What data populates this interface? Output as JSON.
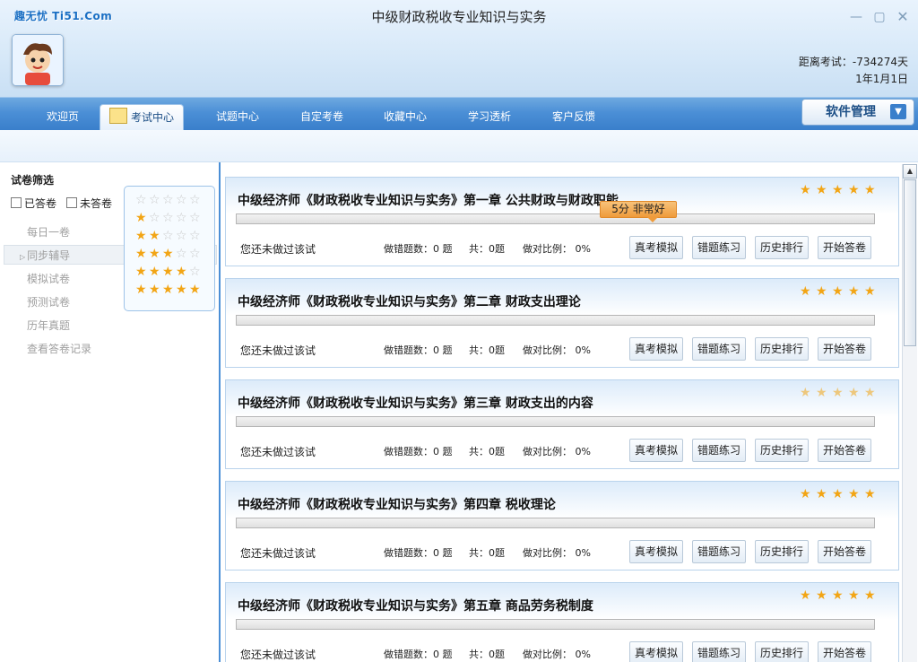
{
  "header": {
    "brand": "趣无忧 Ti51.Com",
    "title": "中级财政税收专业知识与实务",
    "countdown_label": "距离考试：-734274天",
    "date": "1年1月1日"
  },
  "nav": {
    "tabs": [
      "欢迎页",
      "考试中心",
      "试题中心",
      "自定考卷",
      "收藏中心",
      "学习透析",
      "客户反馈"
    ],
    "active": "考试中心",
    "software_button": "软件管理"
  },
  "sidebar": {
    "title": "试卷筛选",
    "checkbox_answered": "已答卷",
    "checkbox_unanswered": "未答卷",
    "menu": [
      "每日一卷",
      "同步辅导",
      "模拟试卷",
      "预测试卷",
      "历年真题",
      "查看答卷记录"
    ],
    "selected": "同步辅导",
    "star_filters": [
      0,
      1,
      2,
      3,
      4,
      5
    ]
  },
  "tooltip": "5分 非常好",
  "cards": [
    {
      "title": "中级经济师《财政税收专业知识与实务》第一章 公共财政与财政职能",
      "status": "您还未做过该试",
      "wrong": "做错题数：0 题",
      "total": "共：0题",
      "ratio": "做对比例： 0%",
      "stars": 5,
      "btn1": "真考模拟",
      "btn2": "错题练习",
      "btn3": "历史排行",
      "btn4": "开始答卷"
    },
    {
      "title": "中级经济师《财政税收专业知识与实务》第二章 财政支出理论",
      "status": "您还未做过该试",
      "wrong": "做错题数：0 题",
      "total": "共：0题",
      "ratio": "做对比例： 0%",
      "stars": 5,
      "btn1": "真考模拟",
      "btn2": "错题练习",
      "btn3": "历史排行",
      "btn4": "开始答卷"
    },
    {
      "title": "中级经济师《财政税收专业知识与实务》第三章 财政支出的内容",
      "status": "您还未做过该试",
      "wrong": "做错题数：0 题",
      "total": "共：0题",
      "ratio": "做对比例： 0%",
      "stars": 5,
      "btn1": "真考模拟",
      "btn2": "错题练习",
      "btn3": "历史排行",
      "btn4": "开始答卷"
    },
    {
      "title": "中级经济师《财政税收专业知识与实务》第四章 税收理论",
      "status": "您还未做过该试",
      "wrong": "做错题数：0 题",
      "total": "共：0题",
      "ratio": "做对比例： 0%",
      "stars": 5,
      "btn1": "真考模拟",
      "btn2": "错题练习",
      "btn3": "历史排行",
      "btn4": "开始答卷"
    },
    {
      "title": "中级经济师《财政税收专业知识与实务》第五章 商品劳务税制度",
      "status": "您还未做过该试",
      "wrong": "做错题数：0 题",
      "total": "共：0题",
      "ratio": "做对比例： 0%",
      "stars": 5,
      "btn1": "真考模拟",
      "btn2": "错题练习",
      "btn3": "历史排行",
      "btn4": "开始答卷"
    }
  ],
  "colors": {
    "accent": "#4b8fd6",
    "star": "#f2a515",
    "tooltip": "#ef9b3b"
  }
}
